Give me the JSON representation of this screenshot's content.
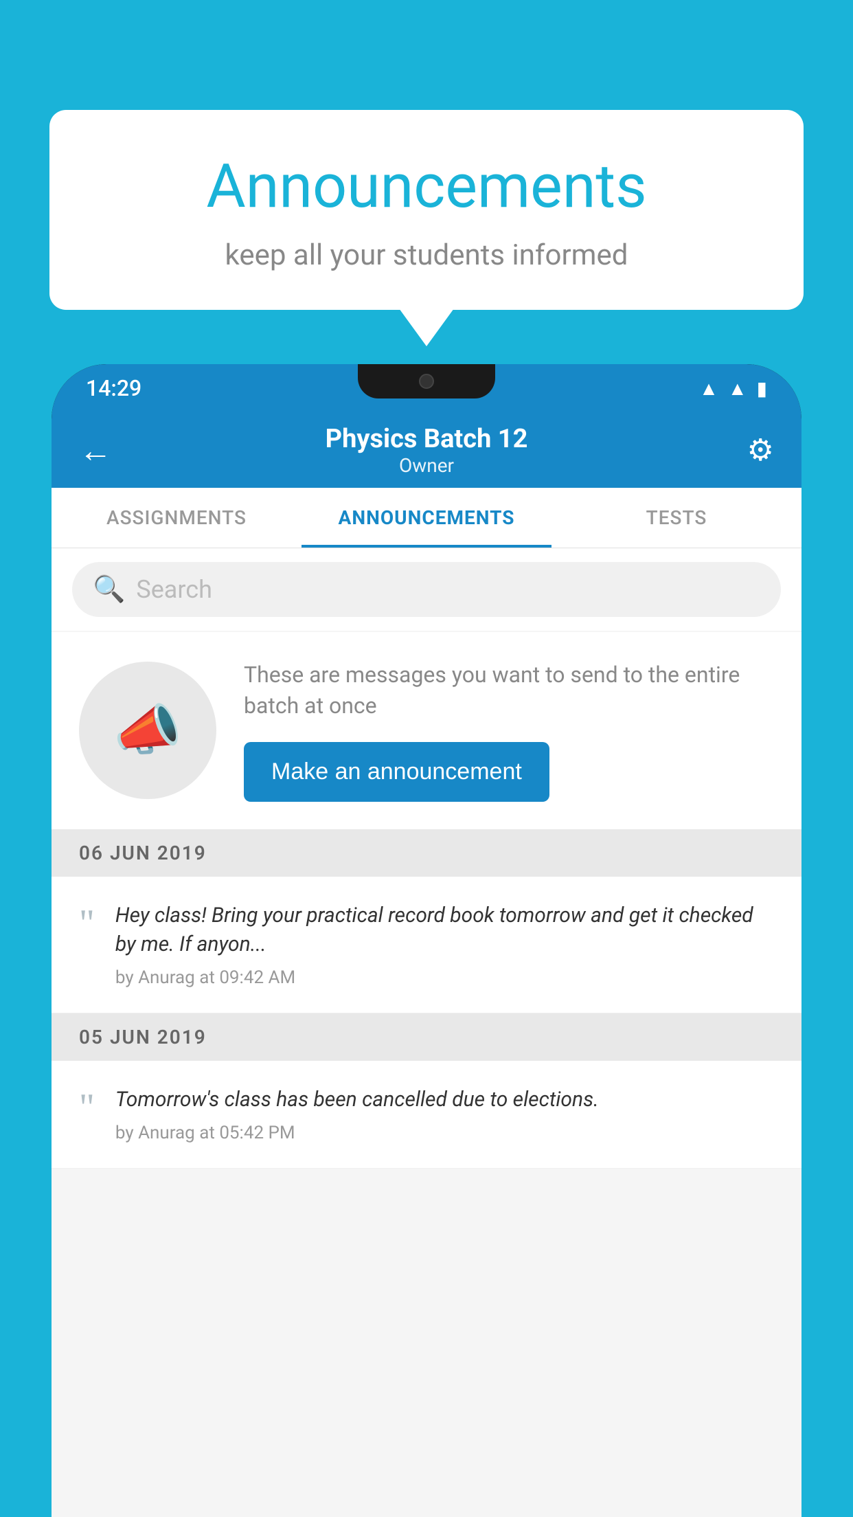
{
  "page": {
    "background_color": "#1ab3d8"
  },
  "speech_bubble": {
    "title": "Announcements",
    "subtitle": "keep all your students informed",
    "title_color": "#1ab3d8",
    "subtitle_color": "#888888"
  },
  "phone": {
    "status_bar": {
      "time": "14:29",
      "icons": [
        "wifi",
        "signal",
        "battery"
      ]
    },
    "app_bar": {
      "title": "Physics Batch 12",
      "subtitle": "Owner",
      "back_label": "←",
      "settings_label": "⚙"
    },
    "tabs": [
      {
        "label": "ASSIGNMENTS",
        "active": false
      },
      {
        "label": "ANNOUNCEMENTS",
        "active": true
      },
      {
        "label": "TESTS",
        "active": false
      }
    ],
    "search": {
      "placeholder": "Search"
    },
    "announcement_prompt": {
      "description": "These are messages you want to send to the entire batch at once",
      "button_label": "Make an announcement"
    },
    "date_groups": [
      {
        "date": "06  JUN  2019",
        "items": [
          {
            "text": "Hey class! Bring your practical record book tomorrow and get it checked by me. If anyon...",
            "meta": "by Anurag at 09:42 AM"
          }
        ]
      },
      {
        "date": "05  JUN  2019",
        "items": [
          {
            "text": "Tomorrow's class has been cancelled due to elections.",
            "meta": "by Anurag at 05:42 PM"
          }
        ]
      }
    ]
  }
}
